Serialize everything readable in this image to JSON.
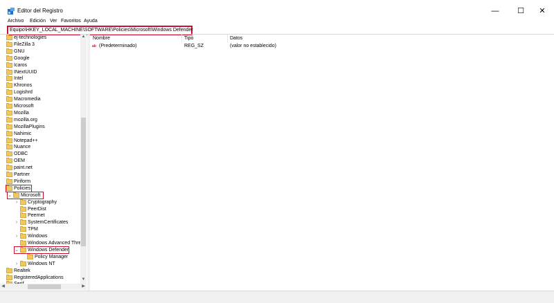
{
  "window": {
    "title": "Editor del Registro",
    "minimize": "—",
    "maximize": "☐",
    "close": "✕"
  },
  "menu": [
    "Archivo",
    "Edición",
    "Ver",
    "Favoritos",
    "Ayuda"
  ],
  "address": "Equipo\\HKEY_LOCAL_MACHINE\\SOFTWARE\\Policies\\Microsoft\\Windows Defender",
  "tree": [
    {
      "label": "ej-technologies",
      "depth": 0,
      "exp": ""
    },
    {
      "label": "FileZilla 3",
      "depth": 0,
      "exp": ""
    },
    {
      "label": "GNU",
      "depth": 0,
      "exp": ""
    },
    {
      "label": "Google",
      "depth": 0,
      "exp": ""
    },
    {
      "label": "Icaros",
      "depth": 0,
      "exp": ""
    },
    {
      "label": "INextUUID",
      "depth": 0,
      "exp": ""
    },
    {
      "label": "Intel",
      "depth": 0,
      "exp": ""
    },
    {
      "label": "Khronos",
      "depth": 0,
      "exp": ""
    },
    {
      "label": "Logishrd",
      "depth": 0,
      "exp": ""
    },
    {
      "label": "Macromedia",
      "depth": 0,
      "exp": ""
    },
    {
      "label": "Microsoft",
      "depth": 0,
      "exp": ""
    },
    {
      "label": "Mozilla",
      "depth": 0,
      "exp": ""
    },
    {
      "label": "mozilla.org",
      "depth": 0,
      "exp": ""
    },
    {
      "label": "MozillaPlugins",
      "depth": 0,
      "exp": ""
    },
    {
      "label": "Nahimic",
      "depth": 0,
      "exp": ""
    },
    {
      "label": "Notepad++",
      "depth": 0,
      "exp": ""
    },
    {
      "label": "Nuance",
      "depth": 0,
      "exp": ""
    },
    {
      "label": "ODBC",
      "depth": 0,
      "exp": ""
    },
    {
      "label": "OEM",
      "depth": 0,
      "exp": ""
    },
    {
      "label": "paint.net",
      "depth": 0,
      "exp": ""
    },
    {
      "label": "Partner",
      "depth": 0,
      "exp": ""
    },
    {
      "label": "Piriform",
      "depth": 0,
      "exp": ""
    },
    {
      "label": "Policies",
      "depth": 0,
      "exp": ""
    },
    {
      "label": "Microsoft",
      "depth": 1,
      "exp": "v"
    },
    {
      "label": "Cryptography",
      "depth": 2,
      "exp": ">"
    },
    {
      "label": "PeerDist",
      "depth": 2,
      "exp": ""
    },
    {
      "label": "Peernet",
      "depth": 2,
      "exp": ""
    },
    {
      "label": "SystemCertificates",
      "depth": 2,
      "exp": ">"
    },
    {
      "label": "TPM",
      "depth": 2,
      "exp": ""
    },
    {
      "label": "Windows",
      "depth": 2,
      "exp": ">"
    },
    {
      "label": "Windows Advanced Threat Protection",
      "depth": 2,
      "exp": ""
    },
    {
      "label": "Windows Defender",
      "depth": 2,
      "exp": "v"
    },
    {
      "label": "Policy Manager",
      "depth": 3,
      "exp": ""
    },
    {
      "label": "Windows NT",
      "depth": 2,
      "exp": ">"
    },
    {
      "label": "Realtek",
      "depth": 0,
      "exp": ""
    },
    {
      "label": "RegisteredApplications",
      "depth": 0,
      "exp": ""
    },
    {
      "label": "Serif",
      "depth": 0,
      "exp": ""
    }
  ],
  "columns": {
    "name": "Nombre",
    "type": "Tipo",
    "data": "Datos"
  },
  "values": [
    {
      "name": "(Predeterminado)",
      "type": "REG_SZ",
      "data": "(valor no establecido)",
      "icon": "ab"
    }
  ],
  "colors": {
    "highlight": "#c8102e",
    "folder": "#f3c75b"
  }
}
